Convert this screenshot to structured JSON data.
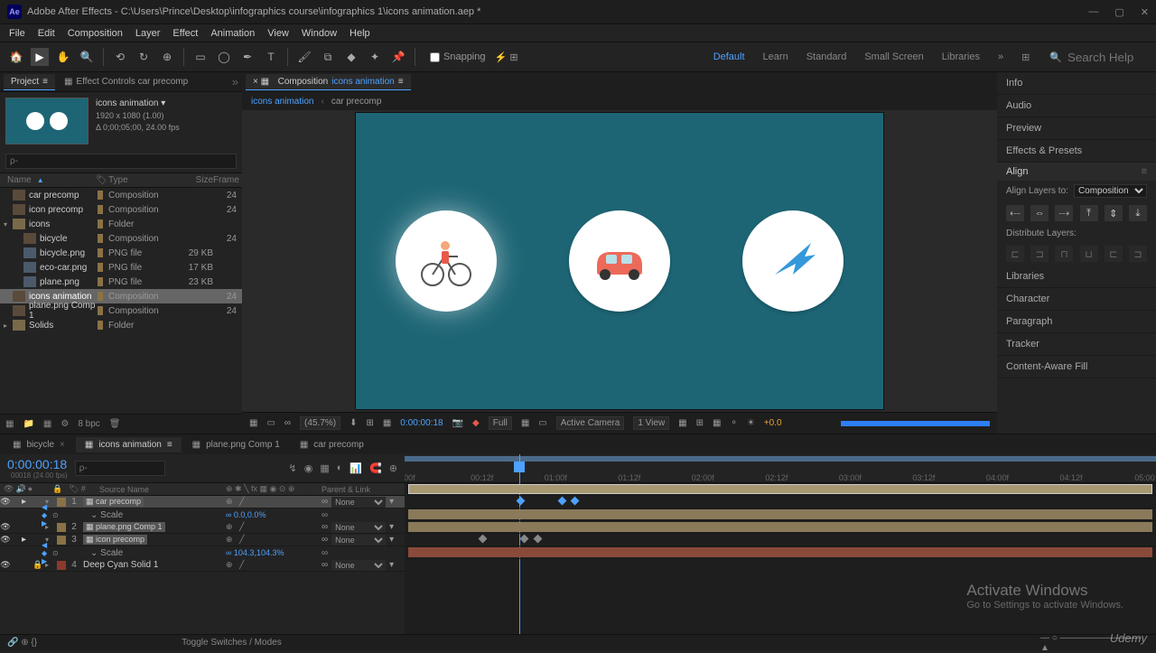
{
  "titlebar": {
    "app_icon": "Ae",
    "title": "Adobe After Effects - C:\\Users\\Prince\\Desktop\\infographics course\\infographics 1\\icons animation.aep *"
  },
  "menu": [
    "File",
    "Edit",
    "Composition",
    "Layer",
    "Effect",
    "Animation",
    "View",
    "Window",
    "Help"
  ],
  "toolbar": {
    "snapping": "Snapping"
  },
  "workspaces": {
    "items": [
      "Default",
      "Learn",
      "Standard",
      "Small Screen",
      "Libraries"
    ],
    "active": "Default"
  },
  "search": {
    "placeholder": "Search Help"
  },
  "project": {
    "panel_label": "Project",
    "ec_label": "Effect Controls car precomp",
    "thumb": {
      "name": "icons animation ▾",
      "res": "1920 x 1080 (1.00)",
      "dur": "Δ 0;00;05;00, 24.00 fps"
    },
    "search_ph": "ρ-",
    "headers": {
      "name": "Name",
      "type": "Type",
      "size": "Size",
      "frame": "Frame"
    },
    "rows": [
      {
        "toggle": "",
        "indent": 0,
        "icon": "comp",
        "name": "car precomp",
        "type": "Composition",
        "size": "",
        "frame": "24"
      },
      {
        "toggle": "",
        "indent": 0,
        "icon": "comp",
        "name": "icon precomp",
        "type": "Composition",
        "size": "",
        "frame": "24"
      },
      {
        "toggle": "▾",
        "indent": 0,
        "icon": "folder",
        "name": "icons",
        "type": "Folder",
        "size": "",
        "frame": ""
      },
      {
        "toggle": "",
        "indent": 1,
        "icon": "comp",
        "name": "bicycle",
        "type": "Composition",
        "size": "",
        "frame": "24"
      },
      {
        "toggle": "",
        "indent": 1,
        "icon": "img",
        "name": "bicycle.png",
        "type": "PNG file",
        "size": "29 KB",
        "frame": ""
      },
      {
        "toggle": "",
        "indent": 1,
        "icon": "img",
        "name": "eco-car.png",
        "type": "PNG file",
        "size": "17 KB",
        "frame": ""
      },
      {
        "toggle": "",
        "indent": 1,
        "icon": "img",
        "name": "plane.png",
        "type": "PNG file",
        "size": "23 KB",
        "frame": ""
      },
      {
        "toggle": "",
        "indent": 0,
        "icon": "comp",
        "name": "icons animation",
        "type": "Composition",
        "size": "",
        "frame": "24",
        "selected": true
      },
      {
        "toggle": "",
        "indent": 0,
        "icon": "comp",
        "name": "plane.png Comp 1",
        "type": "Composition",
        "size": "",
        "frame": "24"
      },
      {
        "toggle": "▸",
        "indent": 0,
        "icon": "folder",
        "name": "Solids",
        "type": "Folder",
        "size": "",
        "frame": ""
      }
    ],
    "footer": {
      "bpc": "8 bpc"
    }
  },
  "composition": {
    "tab_prefix": "Composition",
    "tab_name": "icons animation",
    "crumbs": [
      "icons animation",
      "car precomp"
    ],
    "footer": {
      "zoom": "(45.7%)",
      "time": "0:00:00:18",
      "res": "Full",
      "camera": "Active Camera",
      "view": "1 View",
      "exposure": "+0.0"
    }
  },
  "right": {
    "items_top": [
      "Info",
      "Audio",
      "Preview",
      "Effects & Presets"
    ],
    "align": {
      "title": "Align",
      "label": "Align Layers to:",
      "target": "Composition",
      "dist": "Distribute Layers:"
    },
    "items_bottom": [
      "Libraries",
      "Character",
      "Paragraph",
      "Tracker",
      "Content-Aware Fill"
    ]
  },
  "timeline": {
    "tabs": [
      "bicycle",
      "icons animation",
      "plane.png Comp 1",
      "car precomp"
    ],
    "active_tab": 1,
    "time": "0:00:00:18",
    "subtime": "00018 (24.00 fps)",
    "search_ph": "ρ-",
    "cols": {
      "name": "Source Name",
      "parent": "Parent & Link"
    },
    "ruler": [
      ":00f",
      "00:12f",
      "01:00f",
      "01:12f",
      "02:00f",
      "02:12f",
      "03:00f",
      "03:12f",
      "04:00f",
      "04:12f",
      "05:00"
    ],
    "layers": [
      {
        "num": "1",
        "color": "#8a7245",
        "name": "car precomp",
        "boxed": true,
        "parent": "None",
        "selected": true,
        "expanded": true
      },
      {
        "num": "2",
        "color": "#8a7245",
        "name": "plane.png Comp 1",
        "boxed": true,
        "parent": "None"
      },
      {
        "num": "3",
        "color": "#8a7245",
        "name": "icon precomp",
        "boxed": true,
        "parent": "None",
        "expanded": true
      },
      {
        "num": "4",
        "color": "#8a3a2a",
        "name": "Deep Cyan Solid 1",
        "parent": "None",
        "locked": true
      }
    ],
    "props": {
      "scale": "Scale",
      "v0": "0.0,0.0%",
      "v1": "104.3,104.3%",
      "link": "∞"
    },
    "footer": "Toggle Switches / Modes"
  },
  "activate": {
    "line1": "Activate Windows",
    "line2": "Go to Settings to activate Windows."
  },
  "brand": "Udemy"
}
